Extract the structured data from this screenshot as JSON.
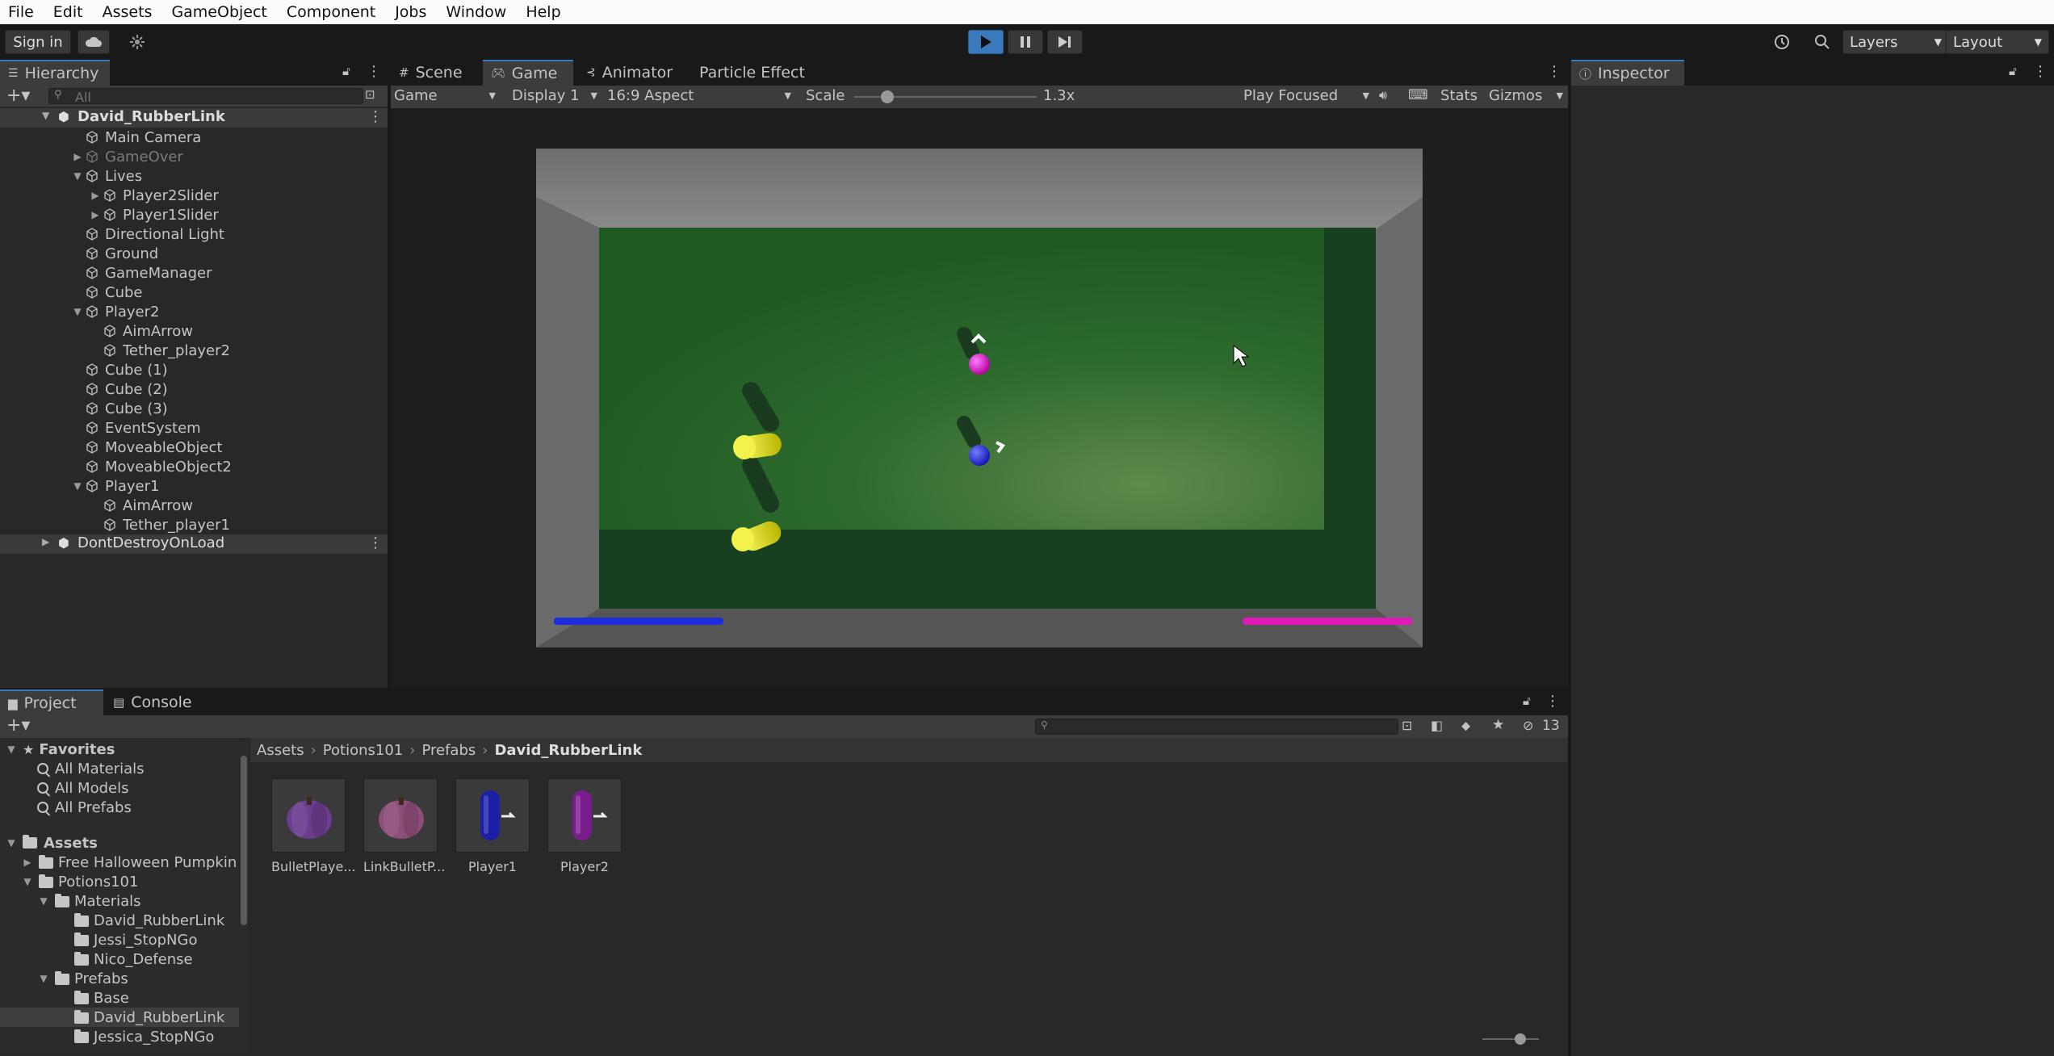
{
  "menu": [
    "File",
    "Edit",
    "Assets",
    "GameObject",
    "Component",
    "Jobs",
    "Window",
    "Help"
  ],
  "toolbar": {
    "sign_in": "Sign in",
    "layers": "Layers",
    "layout": "Layout"
  },
  "hierarchy": {
    "tab": "Hierarchy",
    "search_placeholder": "All",
    "scene_name": "David_RubberLink",
    "items": [
      {
        "label": "Main Camera",
        "depth": 1,
        "expand": "",
        "dim": false
      },
      {
        "label": "GameOver",
        "depth": 1,
        "expand": "right",
        "dim": true
      },
      {
        "label": "Lives",
        "depth": 1,
        "expand": "down",
        "dim": false
      },
      {
        "label": "Player2Slider",
        "depth": 2,
        "expand": "right",
        "dim": false
      },
      {
        "label": "Player1Slider",
        "depth": 2,
        "expand": "right",
        "dim": false
      },
      {
        "label": "Directional Light",
        "depth": 1,
        "expand": "",
        "dim": false
      },
      {
        "label": "Ground",
        "depth": 1,
        "expand": "",
        "dim": false
      },
      {
        "label": "GameManager",
        "depth": 1,
        "expand": "",
        "dim": false
      },
      {
        "label": "Cube",
        "depth": 1,
        "expand": "",
        "dim": false
      },
      {
        "label": "Player2",
        "depth": 1,
        "expand": "down",
        "dim": false
      },
      {
        "label": "AimArrow",
        "depth": 2,
        "expand": "",
        "dim": false
      },
      {
        "label": "Tether_player2",
        "depth": 2,
        "expand": "",
        "dim": false
      },
      {
        "label": "Cube (1)",
        "depth": 1,
        "expand": "",
        "dim": false
      },
      {
        "label": "Cube (2)",
        "depth": 1,
        "expand": "",
        "dim": false
      },
      {
        "label": "Cube (3)",
        "depth": 1,
        "expand": "",
        "dim": false
      },
      {
        "label": "EventSystem",
        "depth": 1,
        "expand": "",
        "dim": false
      },
      {
        "label": "MoveableObject",
        "depth": 1,
        "expand": "",
        "dim": false
      },
      {
        "label": "MoveableObject2",
        "depth": 1,
        "expand": "",
        "dim": false
      },
      {
        "label": "Player1",
        "depth": 1,
        "expand": "down",
        "dim": false
      },
      {
        "label": "AimArrow",
        "depth": 2,
        "expand": "",
        "dim": false
      },
      {
        "label": "Tether_player1",
        "depth": 2,
        "expand": "",
        "dim": false
      }
    ],
    "dontdestroy": "DontDestroyOnLoad"
  },
  "center_tabs": [
    "Scene",
    "Game",
    "Animator",
    "Particle Effect"
  ],
  "game_bar": {
    "mode": "Game",
    "display": "Display 1",
    "aspect": "16:9 Aspect",
    "scale_label": "Scale",
    "scale_value": "1.3x",
    "scale_fraction": 0.18,
    "play": "Play Focused",
    "stats": "Stats",
    "gizmos": "Gizmos"
  },
  "game_view": {
    "p1_bar_color": "#1d2ddb",
    "p2_bar_color": "#e01ab8"
  },
  "inspector": {
    "tab": "Inspector"
  },
  "bottom_tabs": [
    "Project",
    "Console"
  ],
  "project": {
    "hidden_count": "13",
    "breadcrumb": [
      "Assets",
      "Potions101",
      "Prefabs",
      "David_RubberLink"
    ],
    "favorites_label": "Favorites",
    "favorites": [
      "All Materials",
      "All Models",
      "All Prefabs"
    ],
    "assets_label": "Assets",
    "folders": [
      {
        "label": "Free Halloween Pumpkin",
        "depth": 1,
        "expand": "right"
      },
      {
        "label": "Potions101",
        "depth": 1,
        "expand": "down"
      },
      {
        "label": "Materials",
        "depth": 2,
        "expand": "down"
      },
      {
        "label": "David_RubberLink",
        "depth": 3,
        "expand": ""
      },
      {
        "label": "Jessi_StopNGo",
        "depth": 3,
        "expand": ""
      },
      {
        "label": "Nico_Defense",
        "depth": 3,
        "expand": ""
      },
      {
        "label": "Prefabs",
        "depth": 2,
        "expand": "down"
      },
      {
        "label": "Base",
        "depth": 3,
        "expand": ""
      },
      {
        "label": "David_RubberLink",
        "depth": 3,
        "expand": ""
      },
      {
        "label": "Jessica_StopNGo",
        "depth": 3,
        "expand": ""
      }
    ],
    "assets": [
      {
        "label": "BulletPlaye...",
        "kind": "pumpkin",
        "color": "#6b3d8f"
      },
      {
        "label": "LinkBulletP...",
        "kind": "pumpkin",
        "color": "#8e4e7a"
      },
      {
        "label": "Player1",
        "kind": "capsule",
        "color": "#1b1fa8"
      },
      {
        "label": "Player2",
        "kind": "capsule",
        "color": "#7a1c8e"
      }
    ]
  }
}
